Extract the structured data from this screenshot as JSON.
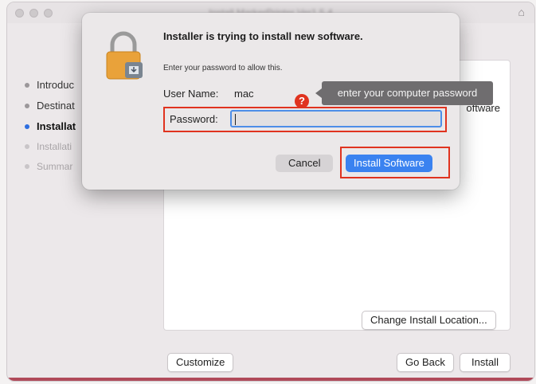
{
  "window": {
    "title": "Install MarkerPrinter Ver1.5.4",
    "sidebar": {
      "steps": [
        "Introduc",
        "Destinat",
        "Installat",
        "Installati",
        "Summar"
      ]
    },
    "panel_text": "oftware",
    "buttons": {
      "change_location": "Change Install Location...",
      "customize": "Customize",
      "go_back": "Go Back",
      "install": "Install"
    }
  },
  "dialog": {
    "title": "Installer is trying to install new software.",
    "description": "Enter your password to allow this.",
    "username_label": "User Name:",
    "username_value": "mac",
    "password_label": "Password:",
    "password_value": "",
    "cancel_label": "Cancel",
    "install_software_label": "Install Software"
  },
  "annotation": {
    "tooltip": "enter your computer password",
    "badge": "?",
    "highlight_color": "#e0331f"
  },
  "colors": {
    "accent": "#3a82f0",
    "active_step": "#2d6ee0"
  }
}
